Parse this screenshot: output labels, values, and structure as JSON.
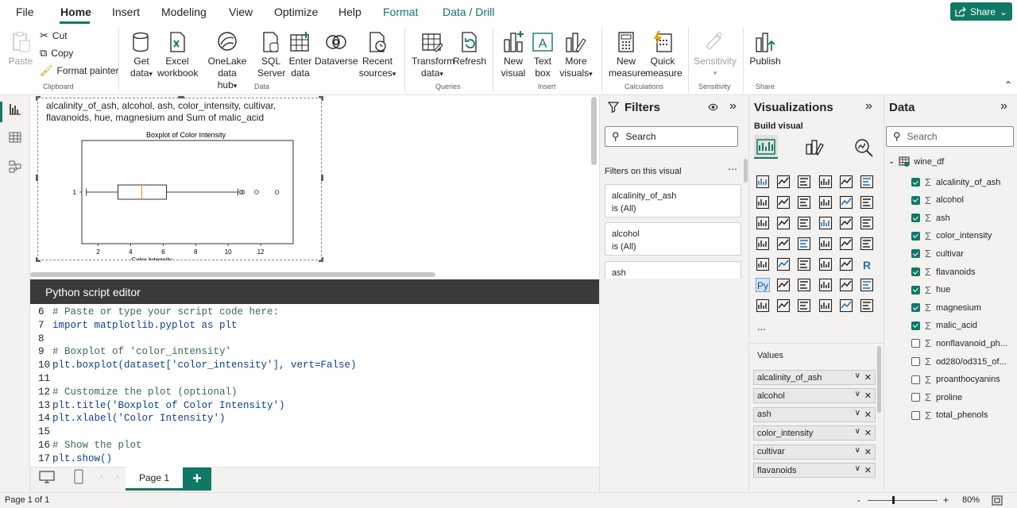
{
  "menu": {
    "items": [
      "File",
      "Home",
      "Insert",
      "Modeling",
      "View",
      "Optimize",
      "Help",
      "Format",
      "Data / Drill"
    ],
    "active": "Home",
    "share_label": "Share"
  },
  "ribbon": {
    "clipboard": {
      "paste": "Paste",
      "cut": "Cut",
      "copy": "Copy",
      "format_painter": "Format painter",
      "group": "Clipboard"
    },
    "data": {
      "get_data": [
        "Get",
        "data"
      ],
      "excel": [
        "Excel",
        "workbook"
      ],
      "onelake": [
        "OneLake data",
        "hub"
      ],
      "sql": [
        "SQL",
        "Server"
      ],
      "enter": [
        "Enter",
        "data"
      ],
      "dataverse": "Dataverse",
      "recent": [
        "Recent",
        "sources"
      ],
      "group": "Data"
    },
    "queries": {
      "transform": [
        "Transform",
        "data"
      ],
      "refresh": "Refresh",
      "group": "Queries"
    },
    "insert": {
      "new_visual": [
        "New",
        "visual"
      ],
      "text_box": [
        "Text",
        "box"
      ],
      "more_visuals": [
        "More",
        "visuals"
      ],
      "group": "Insert"
    },
    "calculations": {
      "new_measure": [
        "New",
        "measure"
      ],
      "quick_measure": [
        "Quick",
        "measure"
      ],
      "group": "Calculations"
    },
    "sensitivity": {
      "label": "Sensitivity",
      "group": "Sensitivity"
    },
    "share": {
      "publish": "Publish",
      "group": "Share"
    }
  },
  "visual": {
    "header": "alcalinity_of_ash, alcohol, ash, color_intensity, cultivar, flavanoids, hue, magnesium and Sum of malic_acid",
    "plot_title": "Boxplot of Color Intensity",
    "xlabel": "Color Intensity",
    "ytick": "1",
    "xticks": [
      "2",
      "4",
      "6",
      "8",
      "10",
      "12"
    ]
  },
  "chart_data": {
    "type": "boxplot",
    "title": "Boxplot of Color Intensity",
    "xlabel": "Color Intensity",
    "category": "1",
    "xlim": [
      1.0,
      14.0
    ],
    "whisker_low": 1.28,
    "q1": 3.22,
    "median": 4.69,
    "q3": 6.2,
    "whisker_high": 10.6,
    "outliers": [
      10.8,
      10.9,
      11.75,
      13.0
    ],
    "median_color": "#ff7f0e"
  },
  "editor": {
    "title": "Python script editor",
    "lines": [
      {
        "n": "6",
        "t": "# Paste or type your script code here:",
        "k": "cm"
      },
      {
        "n": "7",
        "t": "import matplotlib.pyplot as plt",
        "k": "kw"
      },
      {
        "n": "8",
        "t": "",
        "k": "tx"
      },
      {
        "n": "9",
        "t": "# Boxplot of 'color_intensity'",
        "k": "cm"
      },
      {
        "n": "10",
        "t": "plt.boxplot(dataset['color_intensity'], vert=False)",
        "k": "tx"
      },
      {
        "n": "11",
        "t": "",
        "k": "tx"
      },
      {
        "n": "12",
        "t": "# Customize the plot (optional)",
        "k": "cm"
      },
      {
        "n": "13",
        "t": "plt.title('Boxplot of Color Intensity')",
        "k": "tx"
      },
      {
        "n": "14",
        "t": "plt.xlabel('Color Intensity')",
        "k": "tx"
      },
      {
        "n": "15",
        "t": "",
        "k": "tx"
      },
      {
        "n": "16",
        "t": "# Show the plot",
        "k": "cm"
      },
      {
        "n": "17",
        "t": "plt.show()",
        "k": "tx"
      }
    ]
  },
  "pages": {
    "tab": "Page 1",
    "add": "+"
  },
  "status": {
    "page": "Page 1 of 1",
    "zoom": "80%",
    "zoom_minus": "-",
    "zoom_plus": "+"
  },
  "filters": {
    "title": "Filters",
    "search": "Search",
    "section": "Filters on this visual",
    "cards": [
      {
        "name": "alcalinity_of_ash",
        "value": "is (All)"
      },
      {
        "name": "alcohol",
        "value": "is (All)"
      },
      {
        "name": "ash",
        "value": ""
      }
    ]
  },
  "visualizations": {
    "title": "Visualizations",
    "build": "Build visual",
    "values_label": "Values",
    "more": "...",
    "r_label": "R",
    "py_label": "Py",
    "wells": [
      "alcalinity_of_ash",
      "alcohol",
      "ash",
      "color_intensity",
      "cultivar",
      "flavanoids"
    ]
  },
  "data": {
    "title": "Data",
    "search": "Search",
    "table": "wine_df",
    "fields": [
      {
        "name": "alcalinity_of_ash",
        "checked": true
      },
      {
        "name": "alcohol",
        "checked": true
      },
      {
        "name": "ash",
        "checked": true
      },
      {
        "name": "color_intensity",
        "checked": true
      },
      {
        "name": "cultivar",
        "checked": true
      },
      {
        "name": "flavanoids",
        "checked": true
      },
      {
        "name": "hue",
        "checked": true
      },
      {
        "name": "magnesium",
        "checked": true
      },
      {
        "name": "malic_acid",
        "checked": true
      },
      {
        "name": "nonflavanoid_ph...",
        "checked": false
      },
      {
        "name": "od280/od315_of...",
        "checked": false
      },
      {
        "name": "proanthocyanins",
        "checked": false
      },
      {
        "name": "proline",
        "checked": false
      },
      {
        "name": "total_phenols",
        "checked": false
      }
    ]
  },
  "colors": {
    "accent": "#117865",
    "median": "#ff7f0e"
  }
}
